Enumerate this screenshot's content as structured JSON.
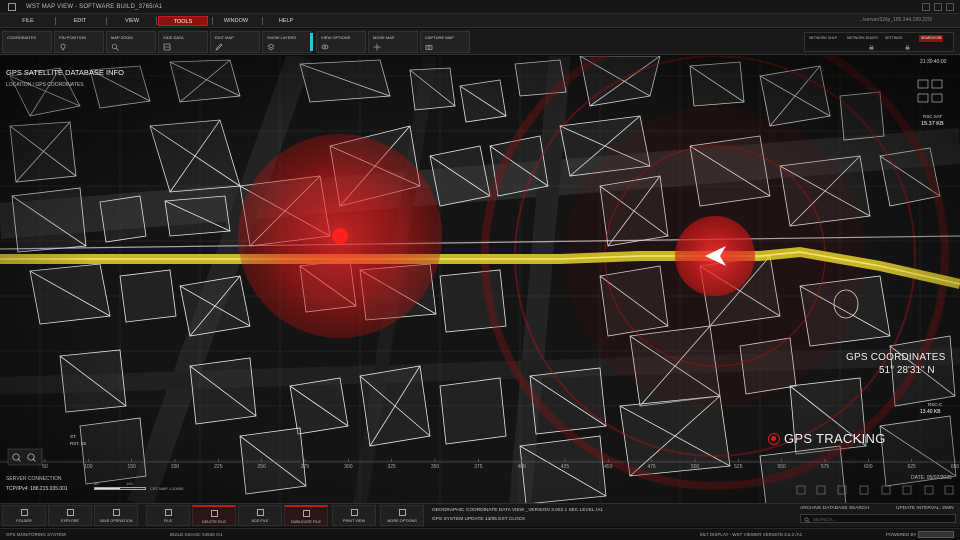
{
  "window": {
    "title": "WST MAP VIEW - SOFTWARE BUILD_3765/A1"
  },
  "menu": {
    "items": [
      "FILE",
      "EDIT",
      "VIEW",
      "TOOLS",
      "WINDOW",
      "HELP"
    ],
    "active": "TOOLS",
    "server_url": "../server/32/ip_185.244.189.220/"
  },
  "toolbar": {
    "items": [
      "COORDINATES",
      "PIN POSITION",
      "MAP ZOOM",
      "SIDE DATA",
      "EDIT MAP",
      "SHOW LAYERS",
      "VIEW OPTIONS",
      "MOVE MAP",
      "CAPTURE MAP"
    ],
    "right_panel": {
      "network_1": "NETWORK DHLP",
      "network_2": "NETWORK ENCRY.",
      "settings": "SETTINGS",
      "search": "SEARCH DB"
    }
  },
  "map": {
    "header": "GPS SATELLITE DATABASE INFO",
    "subheader": "LOCATION / GPS COORDINATES",
    "time": "21:30:40:00",
    "scale_values": [
      "50",
      "100",
      "150",
      "200",
      "225",
      "250",
      "275",
      "300",
      "325",
      "350",
      "375",
      "400",
      "425",
      "450",
      "475",
      "500",
      "525",
      "550",
      "575",
      "600",
      "625",
      "650"
    ],
    "data_box": {
      "label": "RSC SAT",
      "value": "15.37 KB"
    },
    "data_box_2": {
      "label": "RSC-C",
      "value": "13.40 KB"
    },
    "left_tag": {
      "line1": "ST.",
      "line2": "RST. 03"
    },
    "gps_coordinates": {
      "label": "GPS COORDINATES",
      "value": "51° 28'31\" N"
    },
    "gps_tracking": "GPS TRACKING",
    "date": "DATE: 05/07/2035"
  },
  "server": {
    "title": "SERVER CONNECTION",
    "tcp": "TCP/IPv4: 188.215.035.001",
    "scale_left": "50",
    "scale_right": "100",
    "scale_label": "CRT MAP 1:10000"
  },
  "bottom_buttons": [
    "FOLDER",
    "EXPLORE",
    "SAVE OPERATION",
    "FILE",
    "DELETE FILE",
    "ADD FILE",
    "DUBLICATE FILE",
    "PRINT VIEW",
    "MORE OPTIONS"
  ],
  "bottom_info": {
    "line1": "GEOGRAPHIC COORDINATE DATA VIEW _VERSION 3.002.1 SEC.LEVEL /A1",
    "line2": "GPS SYSTEM UPDATE 13/05 EST CLOCK",
    "archive": "ARCHIVE DATABASE SEARCH",
    "update": "UPDATE INTERVAL: 2MIN",
    "search_placeholder": "SEARCH..."
  },
  "statusbar": {
    "left": "GPS MONITORING SYSTEM",
    "build": "BUILD SSAAD: 54546 /A1",
    "right": "MLT DISPLAY - WST VIEWER VERSION 3.5.2 /A1",
    "powered": "POWERED BY"
  },
  "colors": {
    "accent_red": "#c31b1b",
    "route_yellow": "#e6d22a",
    "cyan": "#26c6da",
    "building_line": "#e8e8e8"
  }
}
